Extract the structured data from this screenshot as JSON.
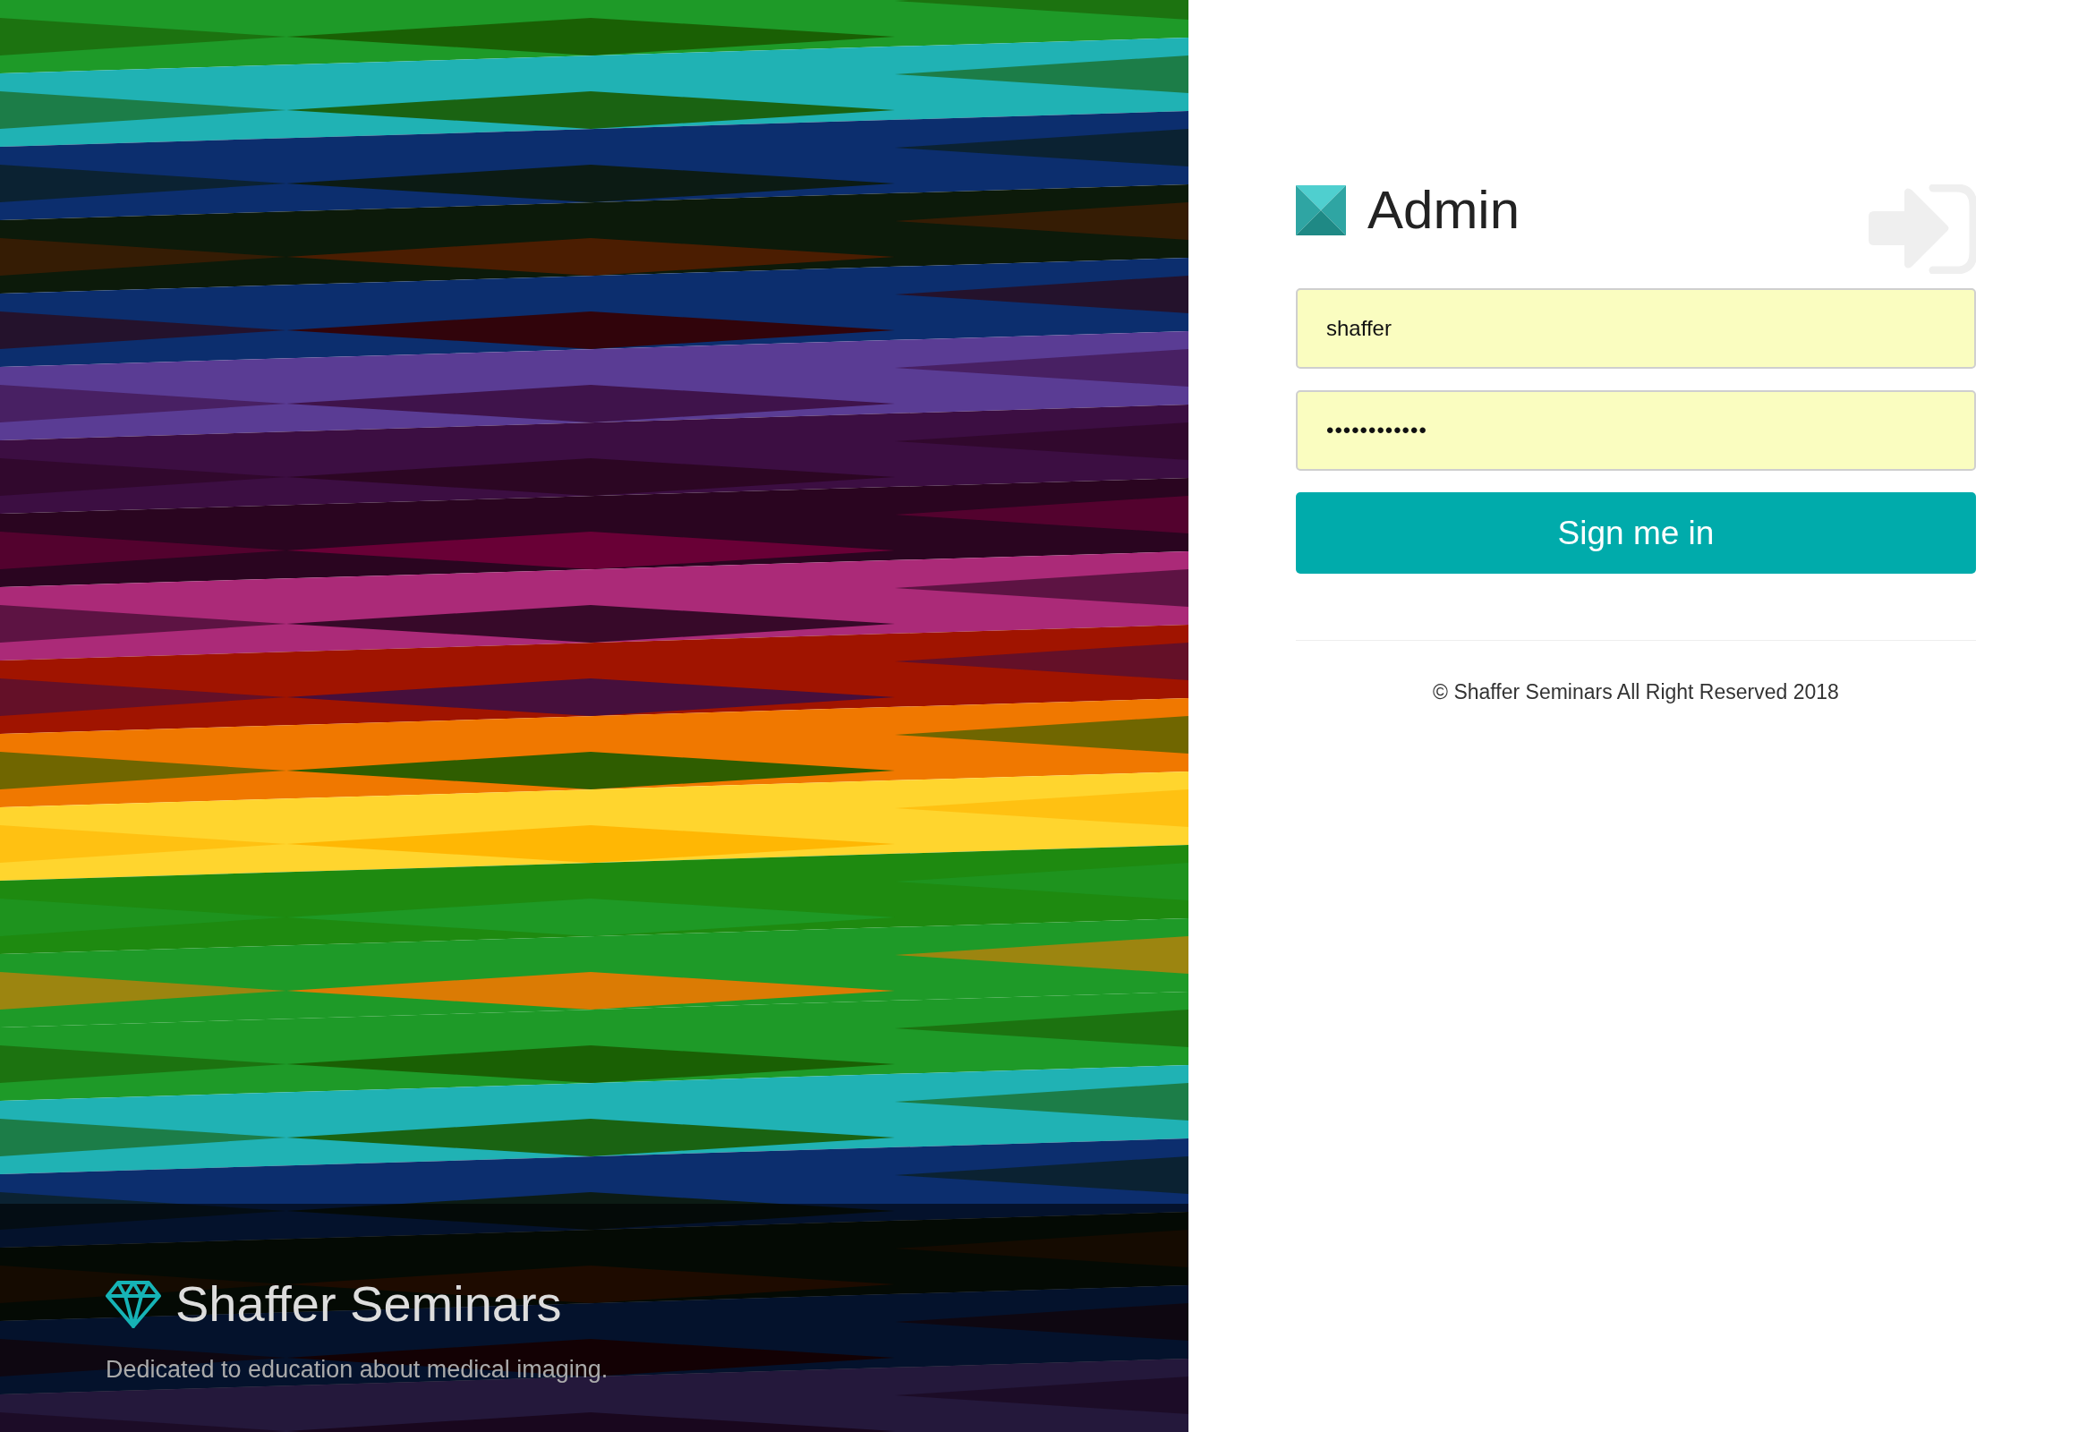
{
  "hero": {
    "title": "Shaffer Seminars",
    "tagline": "Dedicated to education about medical imaging."
  },
  "brand": {
    "name": "Admin"
  },
  "form": {
    "fields": [
      {
        "kind": "text",
        "value": "shaffer"
      },
      {
        "kind": "password",
        "value": "••••••••••••"
      }
    ],
    "submit": "Sign me in"
  },
  "footer": "© Shaffer Seminars All Right Reserved 2018"
}
